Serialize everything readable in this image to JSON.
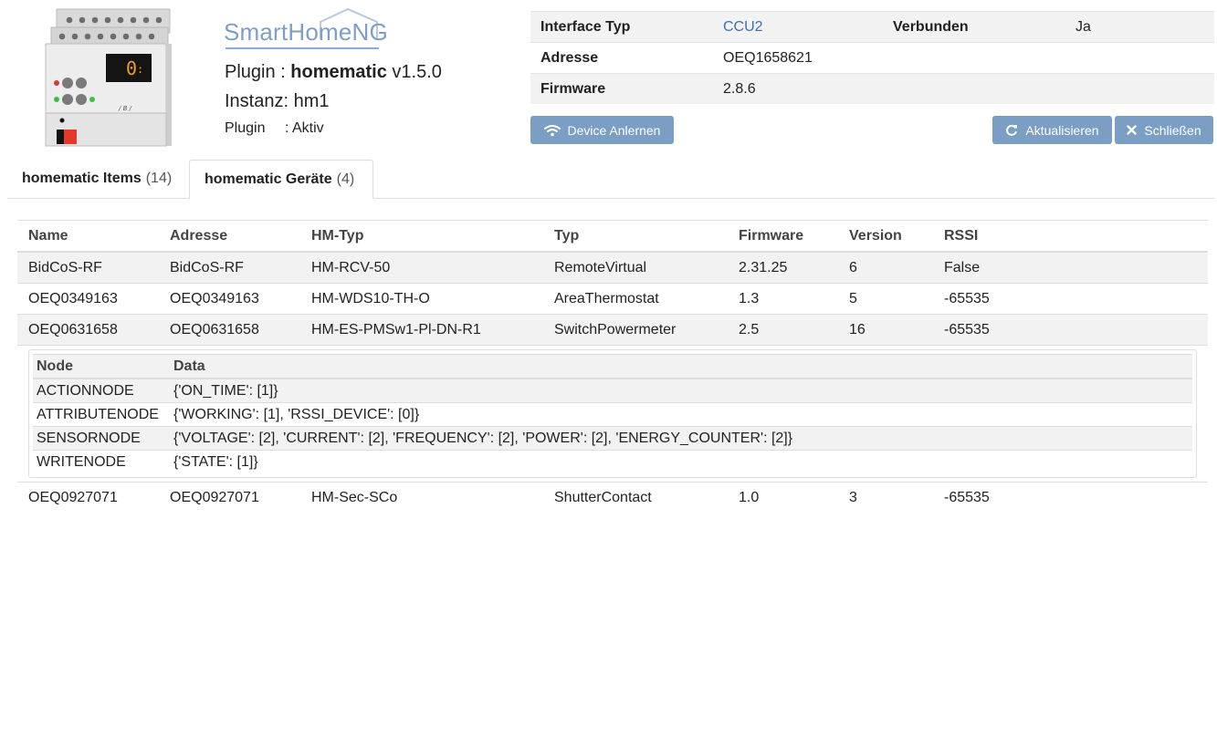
{
  "header": {
    "logo_text": "SmartHomeNG",
    "plugin_label": "Plugin : ",
    "plugin_name": "homematic",
    "plugin_version": "v1.5.0",
    "instance_text": "Instanz: hm1",
    "status_label": "Plugin",
    "status_value": ": Aktiv"
  },
  "info": {
    "rows": [
      {
        "k1": "Interface Typ",
        "v1": "CCU2",
        "k2": "Verbunden",
        "v2": "Ja"
      },
      {
        "k1": "Adresse",
        "v1": "OEQ1658621",
        "k2": "",
        "v2": ""
      },
      {
        "k1": "Firmware",
        "v1": "2.8.6",
        "k2": "",
        "v2": ""
      }
    ]
  },
  "buttons": {
    "learn": "Device Anlernen",
    "refresh": "Aktualisieren",
    "close": "Schließen"
  },
  "tabs": [
    {
      "label": "homematic Items",
      "count": "(14)"
    },
    {
      "label": "homematic Geräte",
      "count": "(4)"
    }
  ],
  "devices": {
    "columns": [
      "Name",
      "Adresse",
      "HM-Typ",
      "Typ",
      "Firmware",
      "Version",
      "RSSI"
    ],
    "rows": [
      {
        "name": "BidCoS-RF",
        "address": "BidCoS-RF",
        "hmtype": "HM-RCV-50",
        "type": "RemoteVirtual",
        "firmware": "2.31.25",
        "version": "6",
        "rssi": "False"
      },
      {
        "name": "OEQ0349163",
        "address": "OEQ0349163",
        "hmtype": "HM-WDS10-TH-O",
        "type": "AreaThermostat",
        "firmware": "1.3",
        "version": "5",
        "rssi": "-65535"
      },
      {
        "name": "OEQ0631658",
        "address": "OEQ0631658",
        "hmtype": "HM-ES-PMSw1-Pl-DN-R1",
        "type": "SwitchPowermeter",
        "firmware": "2.5",
        "version": "16",
        "rssi": "-65535"
      },
      {
        "name": "OEQ0927071",
        "address": "OEQ0927071",
        "hmtype": "HM-Sec-SCo",
        "type": "ShutterContact",
        "firmware": "1.0",
        "version": "3",
        "rssi": "-65535"
      }
    ],
    "nodes": {
      "columns": [
        "Node",
        "Data"
      ],
      "rows": [
        {
          "node": "ACTIONNODE",
          "data": "{'ON_TIME': [1]}"
        },
        {
          "node": "ATTRIBUTENODE",
          "data": "{'WORKING': [1], 'RSSI_DEVICE': [0]}"
        },
        {
          "node": "SENSORNODE",
          "data": "{'VOLTAGE': [2], 'CURRENT': [2], 'FREQUENCY': [2], 'POWER': [2], 'ENERGY_COUNTER': [2]}"
        },
        {
          "node": "WRITENODE",
          "data": "{'STATE': [1]}"
        }
      ]
    }
  },
  "colors": {
    "button": "#7a9ec4",
    "link": "#3b6fb6",
    "logo": "#7e9ec6",
    "stripe": "#f2f2f2"
  },
  "icons": {
    "device": "din-rail-device-icon",
    "learn": "wifi-icon",
    "refresh": "refresh-icon",
    "close": "close-icon"
  }
}
